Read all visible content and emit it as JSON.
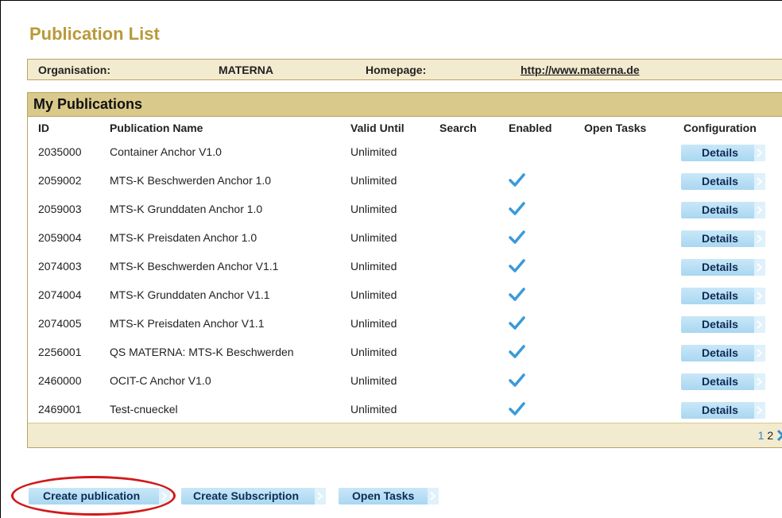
{
  "page": {
    "title": "Publication List"
  },
  "org": {
    "org_label": "Organisation:",
    "org_value": "MATERNA",
    "homepage_label": "Homepage:",
    "homepage_url": "http://www.materna.de"
  },
  "publications": {
    "header": "My Publications",
    "columns": {
      "id": "ID",
      "name": "Publication Name",
      "valid": "Valid Until",
      "search": "Search",
      "enabled": "Enabled",
      "tasks": "Open Tasks",
      "config": "Configuration"
    },
    "details_label": "Details",
    "rows": [
      {
        "id": "2035000",
        "name": "Container Anchor V1.0",
        "valid": "Unlimited",
        "enabled": false
      },
      {
        "id": "2059002",
        "name": "MTS-K Beschwerden Anchor 1.0",
        "valid": "Unlimited",
        "enabled": true
      },
      {
        "id": "2059003",
        "name": "MTS-K Grunddaten Anchor 1.0",
        "valid": "Unlimited",
        "enabled": true
      },
      {
        "id": "2059004",
        "name": "MTS-K Preisdaten Anchor 1.0",
        "valid": "Unlimited",
        "enabled": true
      },
      {
        "id": "2074003",
        "name": "MTS-K Beschwerden Anchor V1.1",
        "valid": "Unlimited",
        "enabled": true
      },
      {
        "id": "2074004",
        "name": "MTS-K Grunddaten Anchor V1.1",
        "valid": "Unlimited",
        "enabled": true
      },
      {
        "id": "2074005",
        "name": "MTS-K Preisdaten Anchor V1.1",
        "valid": "Unlimited",
        "enabled": true
      },
      {
        "id": "2256001",
        "name": "QS MATERNA: MTS-K Beschwerden",
        "valid": "Unlimited",
        "enabled": true
      },
      {
        "id": "2460000",
        "name": "OCIT-C Anchor V1.0",
        "valid": "Unlimited",
        "enabled": true
      },
      {
        "id": "2469001",
        "name": "Test-cnueckel",
        "valid": "Unlimited",
        "enabled": true
      }
    ],
    "pager": {
      "page1": "1",
      "page2": "2",
      "next_icon": "chevron-right-icon"
    }
  },
  "actions": {
    "create_publication": "Create publication",
    "create_subscription": "Create Subscription",
    "open_tasks": "Open Tasks"
  },
  "colors": {
    "title_gold": "#b89a3a",
    "bar_beige": "#f3ebcf",
    "header_tan": "#d9c98a",
    "button_blue": "#a9d7f1",
    "check_blue": "#3a9ad9",
    "highlight_red": "#d11a1a"
  }
}
